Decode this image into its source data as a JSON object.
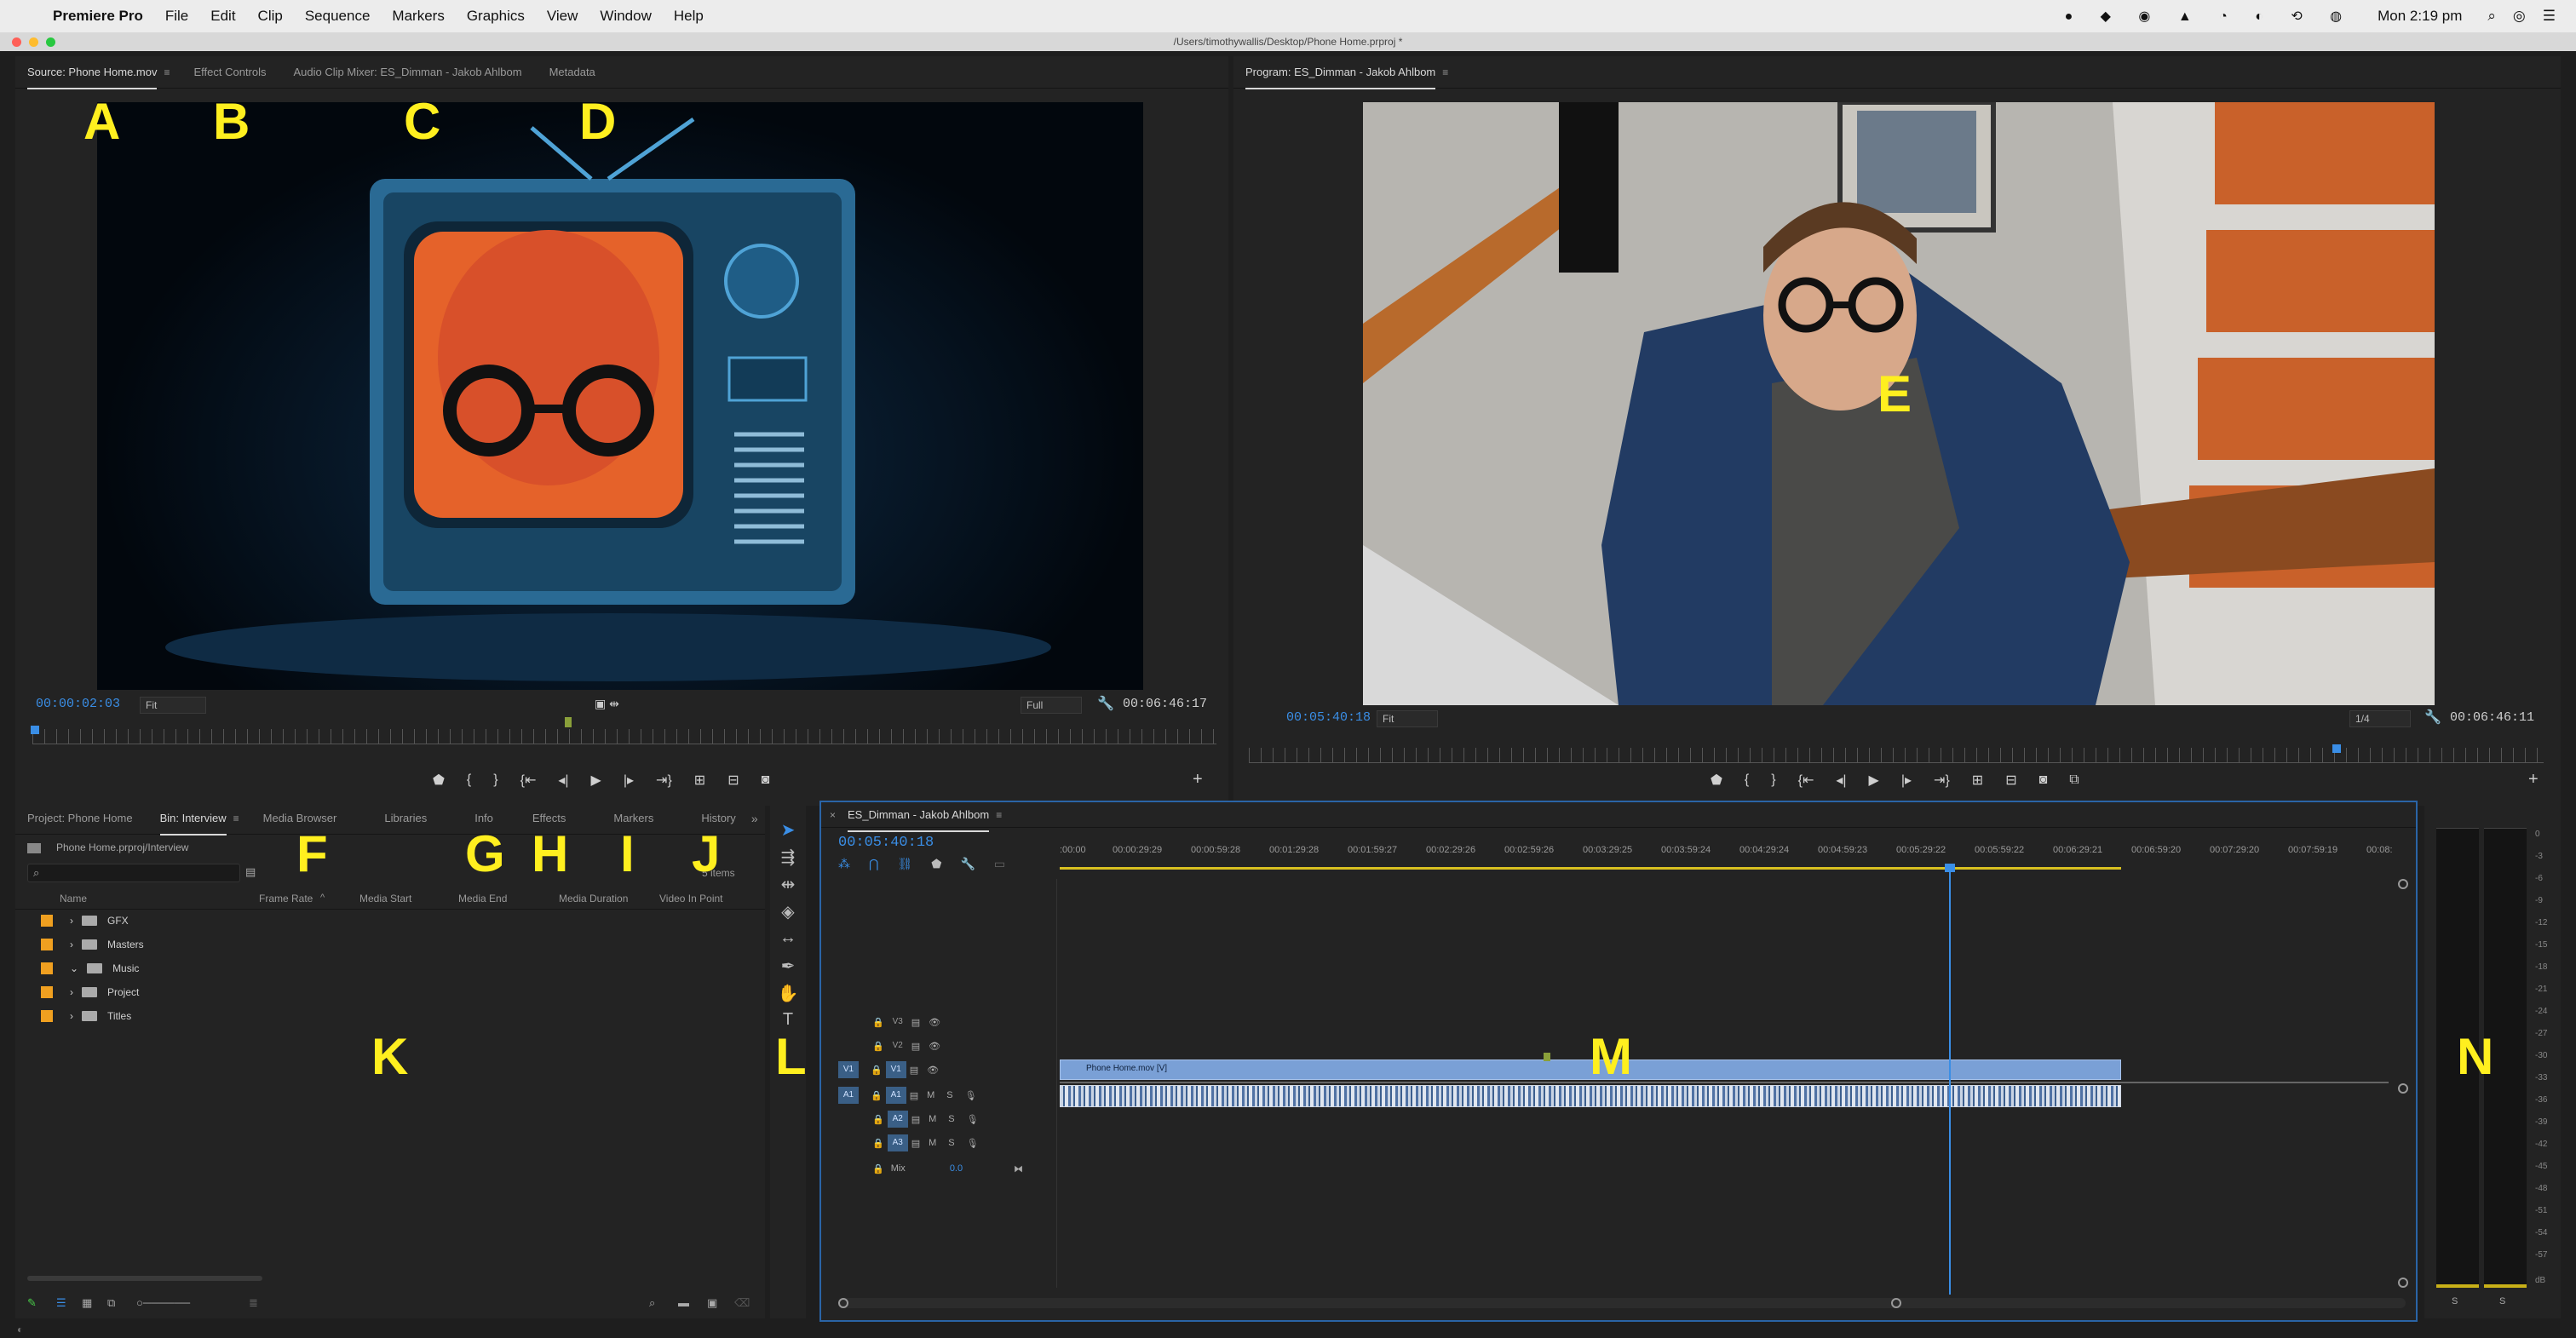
{
  "menubar": {
    "apple": "",
    "app_name": "Premiere Pro",
    "items": [
      "File",
      "Edit",
      "Clip",
      "Sequence",
      "Markers",
      "Graphics",
      "View",
      "Window",
      "Help"
    ],
    "clock": "Mon 2:19 pm"
  },
  "window": {
    "title": "/Users/timothywallis/Desktop/Phone Home.prproj *"
  },
  "source_panel": {
    "tabs": [
      "Source: Phone Home.mov",
      "Effect Controls",
      "Audio Clip Mixer: ES_Dimman - Jakob Ahlbom",
      "Metadata"
    ],
    "timecode": "00:00:02:03",
    "zoom": "Fit",
    "resolution": "Full",
    "duration": "00:06:46:17"
  },
  "program_panel": {
    "tab": "Program: ES_Dimman - Jakob Ahlbom",
    "timecode": "00:05:40:18",
    "zoom": "Fit",
    "resolution": "1/4",
    "duration": "00:06:46:11"
  },
  "project_panel": {
    "tabs": [
      "Project: Phone Home",
      "Bin: Interview",
      "Media Browser",
      "Libraries",
      "Info",
      "Effects",
      "Markers",
      "History"
    ],
    "path": "Phone Home.prproj/Interview",
    "item_count": "5 items",
    "columns": [
      "Name",
      "Frame Rate",
      "Media Start",
      "Media End",
      "Media Duration",
      "Video In Point"
    ],
    "items": [
      "GFX",
      "Masters",
      "Music",
      "Project",
      "Titles"
    ]
  },
  "timeline": {
    "tab": "ES_Dimman - Jakob Ahlbom",
    "timecode": "00:05:40:18",
    "ruler": [
      ":00:00",
      "00:00:29:29",
      "00:00:59:28",
      "00:01:29:28",
      "00:01:59:27",
      "00:02:29:26",
      "00:02:59:26",
      "00:03:29:25",
      "00:03:59:24",
      "00:04:29:24",
      "00:04:59:23",
      "00:05:29:22",
      "00:05:59:22",
      "00:06:29:21",
      "00:06:59:20",
      "00:07:29:20",
      "00:07:59:19",
      "00:08:"
    ],
    "video_tracks": [
      "V3",
      "V2",
      "V1"
    ],
    "audio_tracks": [
      "A1",
      "A2",
      "A3"
    ],
    "mix_label": "Mix",
    "mix_value": "0.0",
    "clip_name": "Phone Home.mov [V]",
    "playhead_fraction": 0.835
  },
  "meters": {
    "scale": [
      "0",
      "-3",
      "-6",
      "-9",
      "-12",
      "-15",
      "-18",
      "-21",
      "-24",
      "-27",
      "-30",
      "-33",
      "-36",
      "-39",
      "-42",
      "-45",
      "-48",
      "-51",
      "-54",
      "-57",
      "dB"
    ],
    "solo": [
      "S",
      "S"
    ]
  },
  "labels": [
    "A",
    "B",
    "C",
    "D",
    "E",
    "F",
    "G",
    "H",
    "I",
    "J",
    "K",
    "L",
    "M",
    "N"
  ],
  "colors": {
    "accent": "#3a8ee6",
    "label": "#ffef1f",
    "folder_label": "#f0a020",
    "clip_video": "#7aa0d6",
    "work_area": "#d8c020"
  }
}
